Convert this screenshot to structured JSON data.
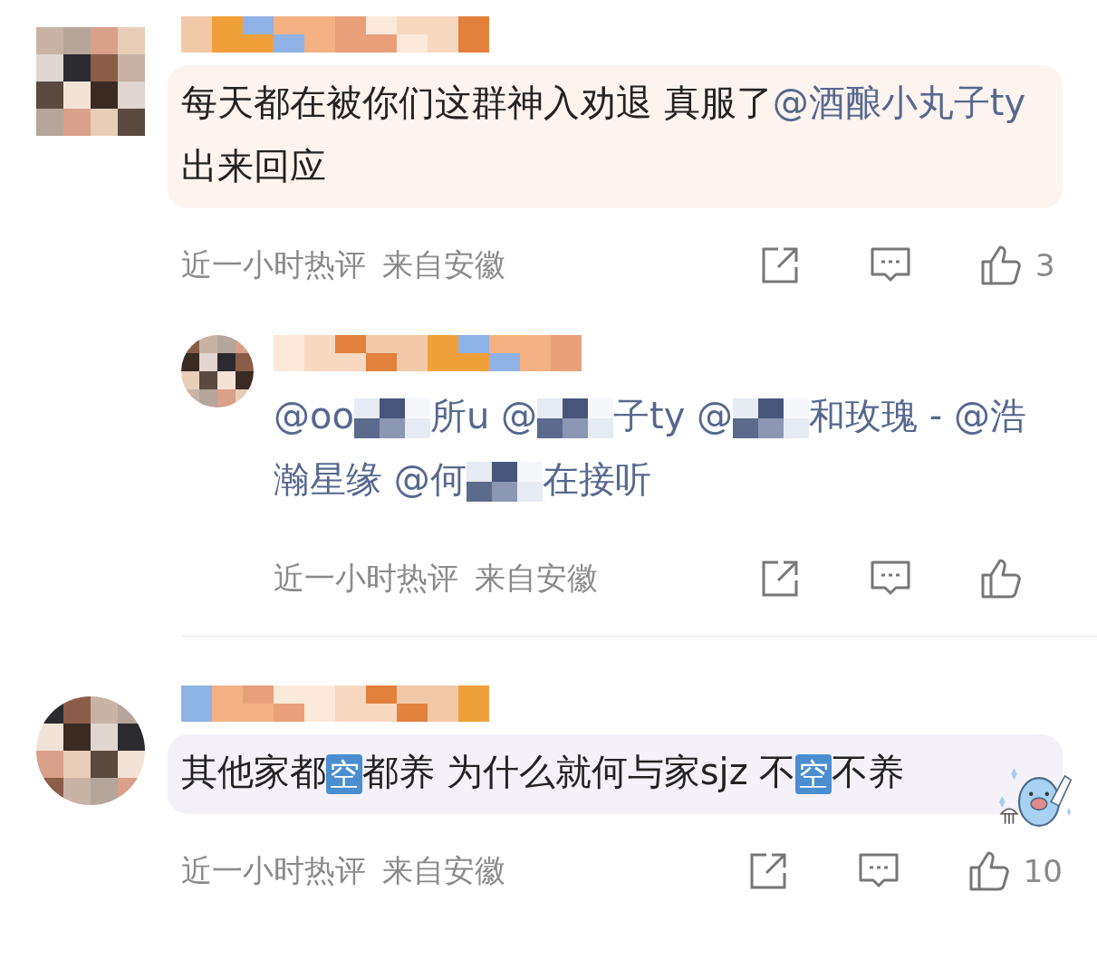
{
  "comments": [
    {
      "kind": "comment",
      "color": "#fdf3ef",
      "body": [
        {
          "kind": "text",
          "text": "每天都在被你们这群神入劝退 真服了"
        },
        {
          "kind": "mention",
          "text": "@酒酿小丸子ty"
        },
        {
          "kind": "text",
          "text": " 出来回应"
        }
      ],
      "time": "近一小时热评",
      "location": "来自安徽",
      "likes": "3"
    },
    {
      "kind": "reply",
      "body": [
        {
          "kind": "mention",
          "text": "@oo"
        },
        {
          "kind": "mosaic"
        },
        {
          "kind": "mention",
          "text": "所u @"
        },
        {
          "kind": "mosaic"
        },
        {
          "kind": "mention",
          "text": "子ty @"
        },
        {
          "kind": "mosaic"
        },
        {
          "kind": "mention",
          "text": "和玫瑰 - @浩瀚星缘 @何"
        },
        {
          "kind": "mosaic"
        },
        {
          "kind": "mention",
          "text": "在接听"
        }
      ],
      "time": "近一小时热评",
      "location": "来自安徽"
    },
    {
      "kind": "comment",
      "color": "#f4f1f9",
      "sticker": true,
      "body": [
        {
          "kind": "text",
          "text": "其他家都"
        },
        {
          "kind": "boxed",
          "text": "空"
        },
        {
          "kind": "text",
          "text": "都养 为什么就何与家sjz 不"
        },
        {
          "kind": "boxed",
          "text": "空"
        },
        {
          "kind": "text",
          "text": "不养"
        }
      ],
      "time": "近一小时热评",
      "location": "来自安徽",
      "likes": "10"
    }
  ]
}
